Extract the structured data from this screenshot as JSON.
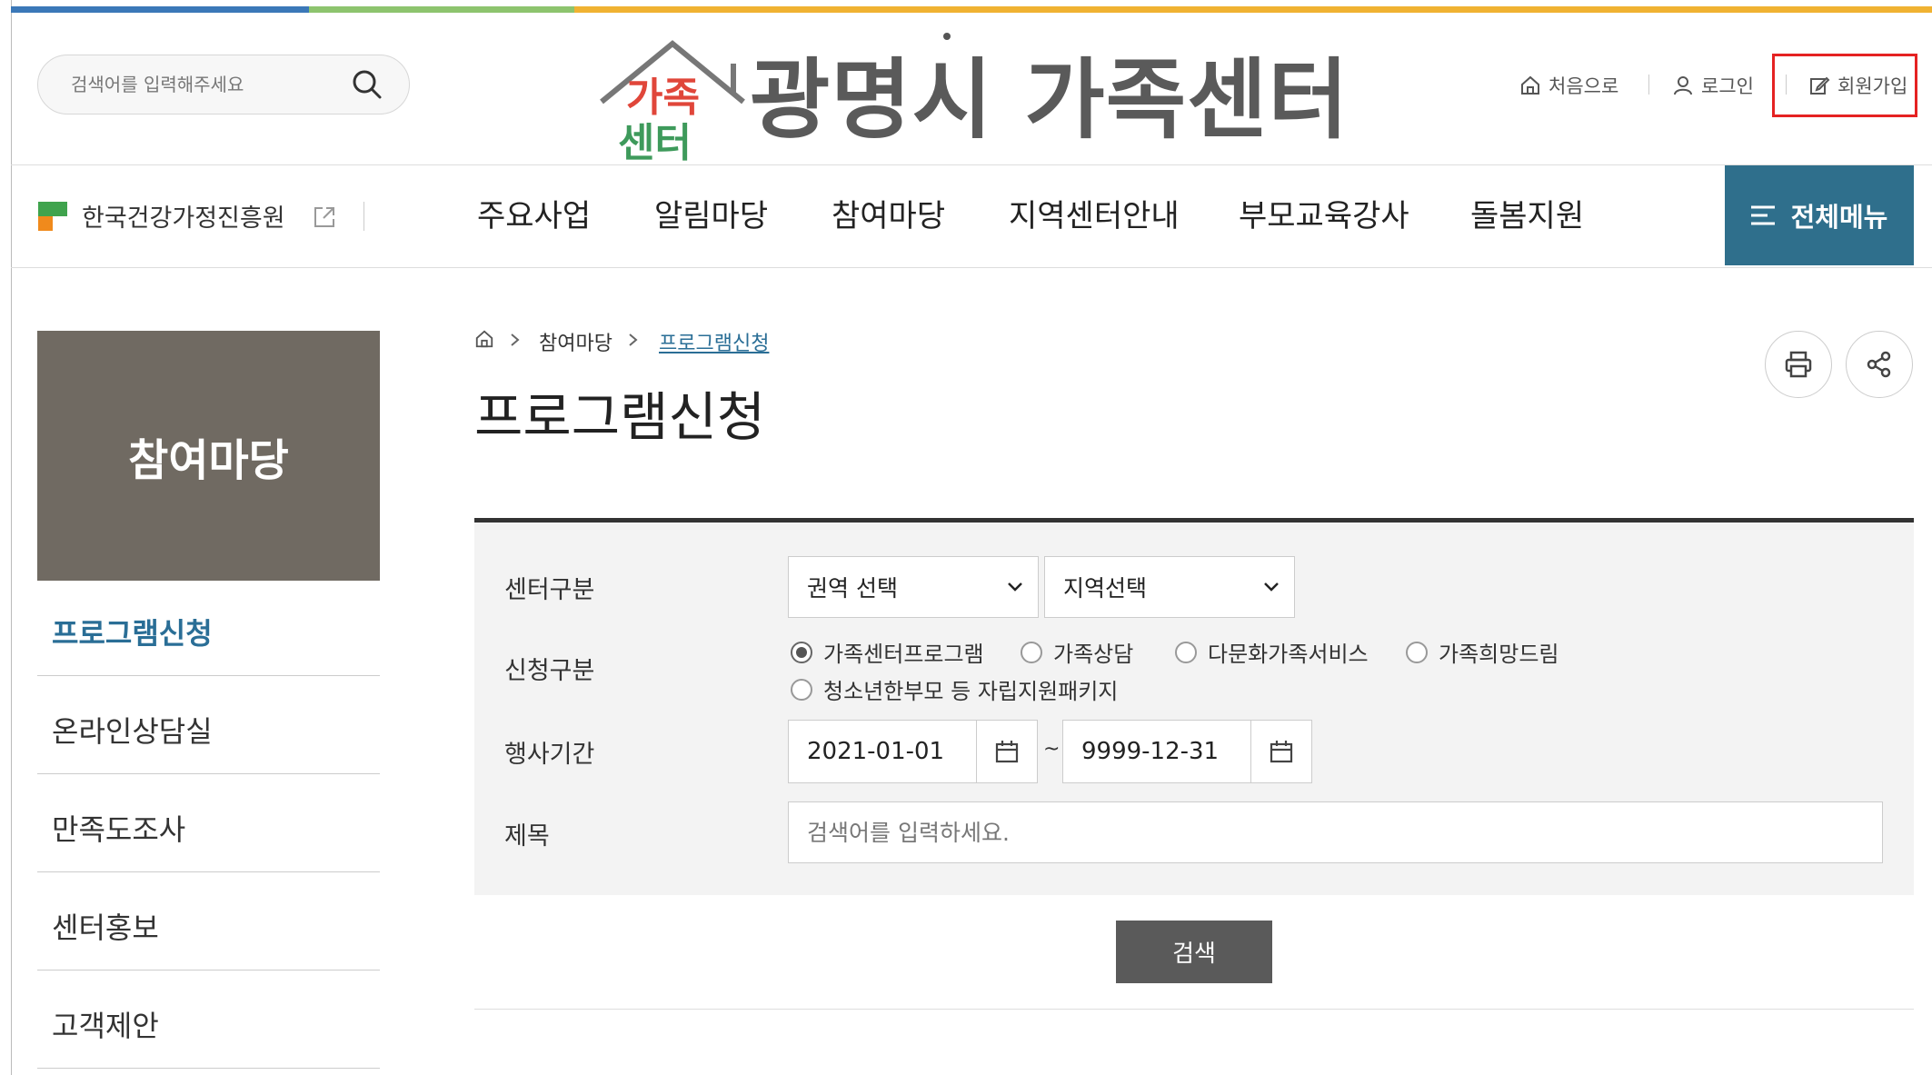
{
  "header": {
    "search_placeholder": "검색어를 입력해주세요",
    "logo_mark_line1": "가족",
    "logo_mark_line2": "센터",
    "site_title": "광명시 가족센터",
    "util": {
      "home": "처음으로",
      "login": "로그인",
      "join": "회원가입"
    }
  },
  "nav": {
    "org_label": "한국건강가정진흥원",
    "menu": [
      "주요사업",
      "알림마당",
      "참여마당",
      "지역센터안내",
      "부모교육강사",
      "돌봄지원"
    ],
    "all_menu": "전체메뉴"
  },
  "sidebar": {
    "title": "참여마당",
    "items": [
      "프로그램신청",
      "온라인상담실",
      "만족도조사",
      "센터홍보",
      "고객제안"
    ]
  },
  "breadcrumb": {
    "level1": "참여마당",
    "level2": "프로그램신청"
  },
  "page_title": "프로그램신청",
  "form": {
    "center_label": "센터구분",
    "region_select": "권역 선택",
    "area_select": "지역선택",
    "type_label": "신청구분",
    "types": [
      "가족센터프로그램",
      "가족상담",
      "다문화가족서비스",
      "가족희망드림",
      "청소년한부모 등 자립지원패키지"
    ],
    "selected_type": "가족센터프로그램",
    "period_label": "행사기간",
    "start_date": "2021-01-01",
    "period_separator": "~",
    "end_date": "9999-12-31",
    "title_label": "제목",
    "title_placeholder": "검색어를 입력하세요.",
    "search_button": "검색"
  },
  "colors": {
    "accent": "#2f6f8c",
    "sidebar_head": "#706a62",
    "active_link": "#2a6e96",
    "highlight_box": "#e52222"
  }
}
